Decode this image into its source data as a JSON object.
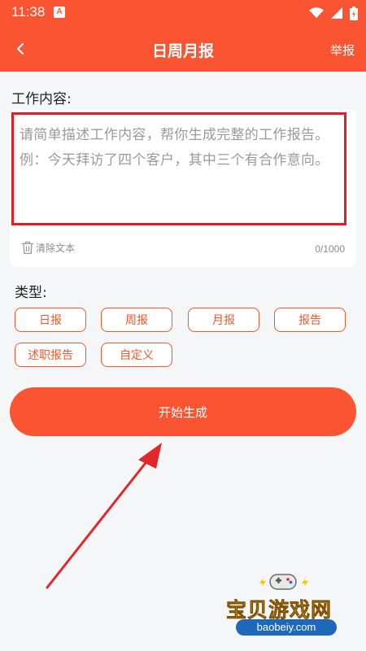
{
  "status_bar": {
    "time": "11:38",
    "app_badge": "A"
  },
  "nav": {
    "title": "日周月报",
    "report_label": "举报"
  },
  "content_section": {
    "label": "工作内容:",
    "placeholder": "请简单描述工作内容，帮你生成完整的工作报告。例：今天拜访了四个客户，其中三个有合作意向。",
    "clear_label": "清除文本",
    "char_count": "0/1000"
  },
  "type_section": {
    "label": "类型:",
    "types": [
      "日报",
      "周报",
      "月报",
      "报告",
      "述职报告",
      "自定义"
    ]
  },
  "start_button": "开始生成",
  "watermark": {
    "title": "宝贝游戏网",
    "url": "baobeiy.com"
  },
  "colors": {
    "primary": "#fa5433",
    "chip_border": "#f0592f",
    "highlight_border": "#e11c24",
    "annotation_arrow": "#e3262a",
    "background": "#f5f6f8"
  }
}
